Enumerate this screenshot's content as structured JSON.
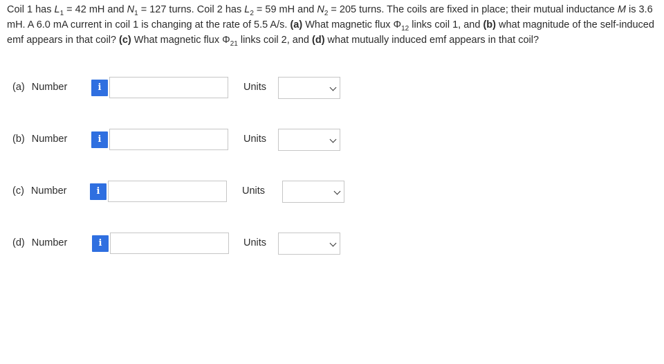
{
  "question": {
    "p1": "Coil 1 has ",
    "L1_sym": "L",
    "L1_sub": "1",
    "p2": " = 42 mH and ",
    "N1_sym": "N",
    "N1_sub": "1",
    "p3": " = 127 turns. Coil 2 has ",
    "L2_sym": "L",
    "L2_sub": "2",
    "p4": " = 59 mH and ",
    "N2_sym": "N",
    "N2_sub": "2",
    "p5": " = 205 turns. The coils are fixed in place; their mutual inductance ",
    "M_sym": "M",
    "p6": " is 3.6 mH. A 6.0 mA current in coil 1 is changing at the rate of 5.5 A/s. ",
    "a_tag": "(a)",
    "p7": " What magnetic flux Φ",
    "phi12_sub": "12",
    "p8": " links coil 1, and ",
    "b_tag": "(b)",
    "p9": " what magnitude of the self-induced emf appears in that coil? ",
    "c_tag": "(c)",
    "p10": " What magnetic flux Φ",
    "phi21_sub": "21",
    "p11": " links coil 2, and ",
    "d_tag": "(d)",
    "p12": " what mutually induced emf appears in that coil?"
  },
  "rows": [
    {
      "part": "(a)",
      "number_label": "Number",
      "info_glyph": "i",
      "value": "",
      "units_label": "Units",
      "units_selected": ""
    },
    {
      "part": "(b)",
      "number_label": "Number",
      "info_glyph": "i",
      "value": "",
      "units_label": "Units",
      "units_selected": ""
    },
    {
      "part": "(c)",
      "number_label": "Number",
      "info_glyph": "i",
      "value": "",
      "units_label": "Units",
      "units_selected": ""
    },
    {
      "part": "(d)",
      "number_label": "Number",
      "info_glyph": "i",
      "value": "",
      "units_label": "Units",
      "units_selected": ""
    }
  ],
  "colors": {
    "info_button": "#2f6fe0",
    "input_border": "#c6c6c6",
    "text": "#2d2d2d"
  }
}
